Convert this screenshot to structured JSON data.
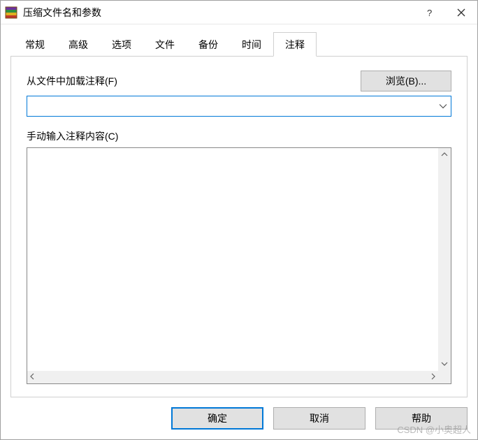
{
  "title_bar": {
    "title": "压缩文件名和参数"
  },
  "tabs": {
    "items": [
      {
        "label": "常规"
      },
      {
        "label": "高级"
      },
      {
        "label": "选项"
      },
      {
        "label": "文件"
      },
      {
        "label": "备份"
      },
      {
        "label": "时间"
      },
      {
        "label": "注释"
      }
    ],
    "active_index": 6
  },
  "comment_tab": {
    "load_label": "从文件中加载注释(F)",
    "browse_label": "浏览(B)...",
    "file_value": "",
    "manual_label": "手动输入注释内容(C)",
    "manual_value": ""
  },
  "footer": {
    "ok": "确定",
    "cancel": "取消",
    "help": "帮助"
  },
  "watermark": "CSDN @小奥超人"
}
